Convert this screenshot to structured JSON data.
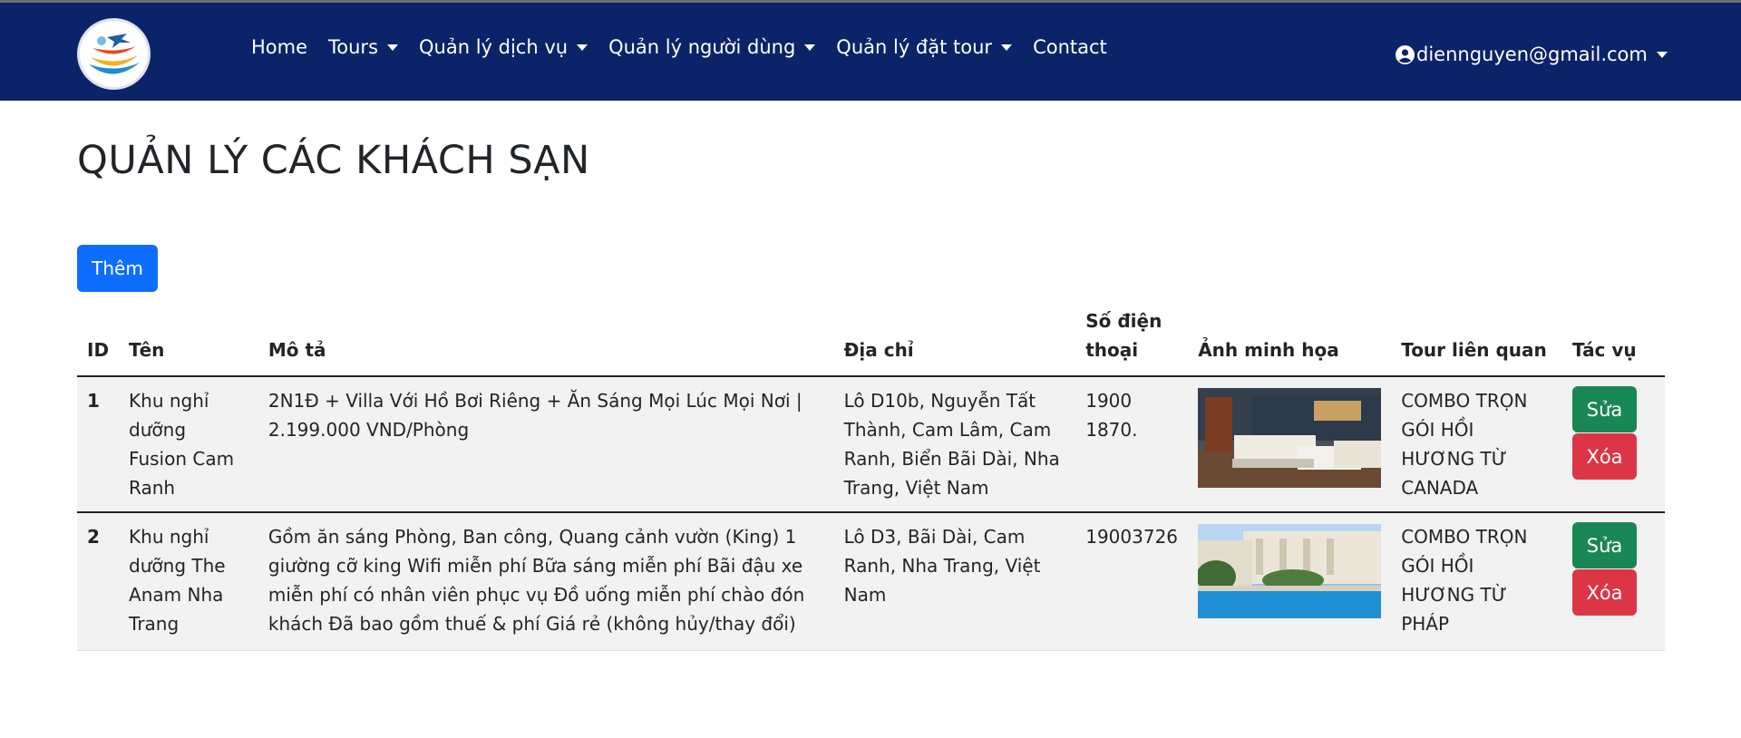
{
  "navbar": {
    "logo_icon": "travel-plane-globe-icon",
    "links": [
      {
        "label": "Home",
        "dropdown": false
      },
      {
        "label": "Tours",
        "dropdown": true
      },
      {
        "label": "Quản lý dịch vụ",
        "dropdown": true
      },
      {
        "label": "Quản lý người dùng",
        "dropdown": true
      },
      {
        "label": "Quản lý đặt tour",
        "dropdown": true
      },
      {
        "label": "Contact",
        "dropdown": false
      }
    ],
    "user_email": "diennguyen@gmail.com",
    "background_color": "#0b2368"
  },
  "page": {
    "title": "QUẢN LÝ CÁC KHÁCH SẠN",
    "add_button": "Thêm"
  },
  "table": {
    "headers": {
      "id": "ID",
      "name": "Tên",
      "description": "Mô tả",
      "address": "Địa chỉ",
      "phone": "Số điện thoại",
      "image": "Ảnh minh họa",
      "tour": "Tour liên quan",
      "actions": "Tác vụ"
    },
    "rows": [
      {
        "id": "1",
        "name": "Khu nghỉ dưỡng Fusion Cam Ranh",
        "description": "2N1Đ + Villa Với Hồ Bơi Riêng + Ăn Sáng Mọi Lúc Mọi Nơi | 2.199.000 VND/Phòng",
        "address": "Lô D10b, Nguyễn Tất Thành, Cam Lâm, Cam Ranh, Biển Bãi Dài, Nha Trang, Việt Nam",
        "phone": "1900 1870.",
        "image": "hotel-room-photo",
        "tour": "COMBO TRỌN GÓI HỒI HƯƠNG TỪ CANADA",
        "edit_label": "Sửa",
        "delete_label": "Xóa"
      },
      {
        "id": "2",
        "name": "Khu nghỉ dưỡng The Anam Nha Trang",
        "description": "Gồm ăn sáng Phòng, Ban công, Quang cảnh vườn (King) 1 giường cỡ king Wifi miễn phí Bữa sáng miễn phí Bãi đậu xe miễn phí có nhân viên phục vụ Đồ uống miễn phí chào đón khách Đã bao gồm thuế & phí Giá rẻ (không hủy/thay đổi)",
        "address": "Lô D3, Bãi Dài, Cam Ranh, Nha Trang, Việt Nam",
        "phone": "19003726",
        "image": "hotel-pool-photo",
        "tour": "COMBO TRỌN GÓI HỒI HƯƠNG TỪ PHÁP",
        "edit_label": "Sửa",
        "delete_label": "Xóa"
      }
    ]
  },
  "colors": {
    "primary": "#0d6efd",
    "success": "#198754",
    "danger": "#dc3545"
  }
}
